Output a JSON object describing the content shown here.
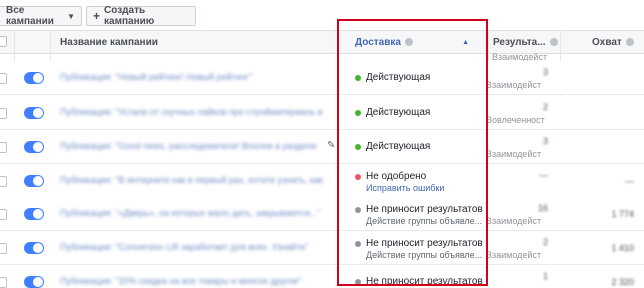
{
  "toolbar": {
    "all_campaigns": "Все кампании",
    "create_campaign": "Создать кампанию"
  },
  "columns": {
    "campaign_name": "Название кампании",
    "delivery": "Доставка",
    "results": "Результа...",
    "reach": "Охват"
  },
  "colors": {
    "active": "#42b72a",
    "disapproved": "#f25268",
    "inactive": "#90949c",
    "highlight": "#d0021b"
  },
  "rows": [
    {
      "name": "Публикация: \"Новый рейтинг! Новый рейтинг\"",
      "status": "Действующая",
      "sub": "",
      "state": "active",
      "result": "3",
      "result_label": "Взаимодейст",
      "reach": ""
    },
    {
      "name": "Публикация: \"Устали от скучных лайков про стройматериаль в",
      "status": "Действующая",
      "sub": "",
      "state": "active",
      "result": "2",
      "result_label": "Вовлеченност",
      "reach": ""
    },
    {
      "name": "Публикация: \"Good news, расследователи! Вполне в разделе",
      "status": "Действующая",
      "sub": "",
      "state": "active",
      "result": "3",
      "result_label": "Взаимодейст",
      "reach": ""
    },
    {
      "name": "Публикация: \"В интернете как в первый раз, хотите узнать, как",
      "status": "Не одобрено",
      "sub": "Исправить ошибки",
      "state": "disapproved",
      "result": "—",
      "result_label": "",
      "reach": "—"
    },
    {
      "name": "Публикация: \"«Дверь», на которых мало дать, закрываются...\"",
      "status": "Не приносит результатов",
      "sub": "Действие группы объявле...",
      "state": "inactive",
      "result": "16",
      "result_label": "Взаимодейст",
      "reach": "1 774"
    },
    {
      "name": "Публикация: \"Conversion Lift заработает для всех. Узнайте\"",
      "status": "Не приносит результатов",
      "sub": "Действие группы объявле...",
      "state": "inactive",
      "result": "2",
      "result_label": "Взаимодейст",
      "reach": "1 410"
    },
    {
      "name": "Публикация: \"20% скидка на все товары и многое другое\"",
      "status": "Не приносит результатов",
      "sub": "",
      "state": "inactive",
      "result": "1",
      "result_label": "",
      "reach": "2 320"
    }
  ],
  "partial_header_result_label": "Взаимодейст"
}
